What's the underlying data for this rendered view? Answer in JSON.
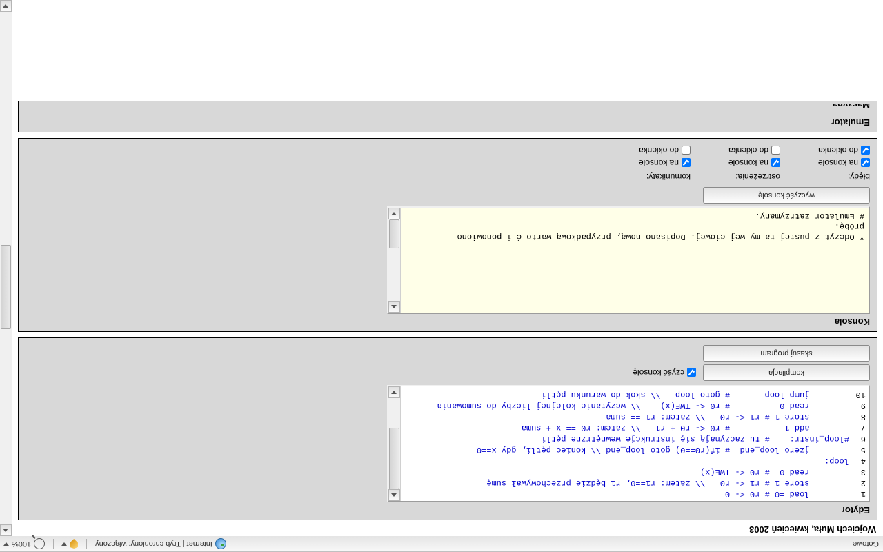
{
  "statusbar": {
    "left": "Gotowe",
    "zone": "Internet | Tryb chroniony: włączony",
    "zoom": "100%"
  },
  "author_line": "Wojciech Muła, kwiecień 2003",
  "editor": {
    "title": "Edytor",
    "lines": [
      {
        "n": "1",
        "t": "        load =0 # r0 <- 0"
      },
      {
        "n": "2",
        "t": "        store 1 # r1 <- r0   \\\\ zatem: r1==0, r1 będzie przechowywał sumę"
      },
      {
        "n": "3",
        "t": "        read 0  # r0 <- TWE(x)"
      },
      {
        "n": "4",
        "t": "loop:"
      },
      {
        "n": "5",
        "t": "        jzero loop_end  # if(r0==0) goto loop_end \\\\ koniec pętli, gdy x==0"
      },
      {
        "n": "6",
        "t": "#loop_instr:    # tu zaczynają się instrukcje wewnętrzne pętli"
      },
      {
        "n": "7",
        "t": "        add 1           # r0 <- r0 + r1   \\\\ zatem: r0 == x + suma"
      },
      {
        "n": "8",
        "t": "        store 1 # r1 <- r0   \\\\ zatem: r1 == suma"
      },
      {
        "n": "9",
        "t": "        read 0          # r0 <- TWE(x)    \\\\ wczytanie kolejnej liczby do sumowania"
      },
      {
        "n": "10",
        "t": "        jump loop       # goto loop   \\\\ skok do warunku pętli"
      }
    ],
    "compile_btn": "kompilacja",
    "clear_btn": "skasuj program",
    "clear_console_label": "czyść konsolę"
  },
  "console": {
    "title": "Konsola",
    "clear_btn": "wyczyść konsolę",
    "lines_bottom_up": [
      "# Emulator zatrzymany.",
      "próbę.",
      "* Odczyt z pustej ta my wej ciowej. Dopisano nową, przypadkową warto ć i ponowiono"
    ],
    "report": {
      "errors_hdr": "błędy:",
      "warnings_hdr": "ostrzeżenia:",
      "messages_hdr": "komunikaty:",
      "to_console": "na konsole",
      "to_window": "do okienka"
    }
  },
  "emulator": {
    "title": "Emulator",
    "cutoff_title": "Maszyna"
  }
}
